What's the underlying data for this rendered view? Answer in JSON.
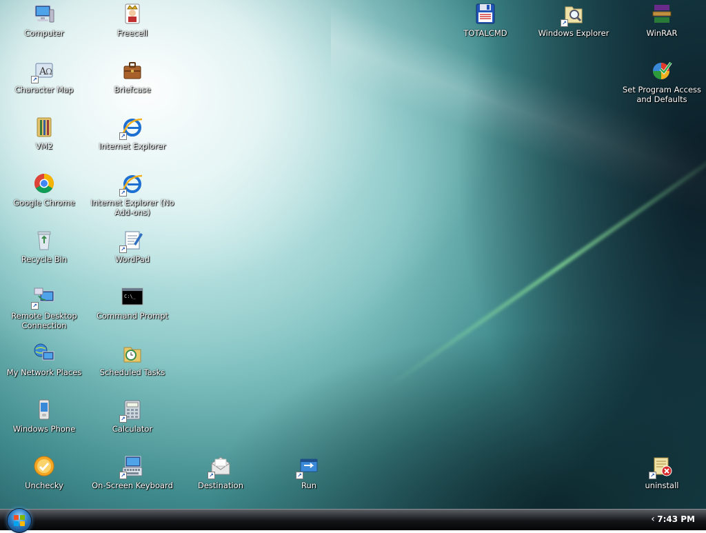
{
  "desktop": {
    "icons": {
      "computer": "Computer",
      "freecell": "Freecell",
      "totalcmd": "TOTALCMD",
      "windows_explorer": "Windows Explorer",
      "winrar": "WinRAR",
      "character_map": "Character Map",
      "briefcase": "Briefcase",
      "set_program_access": "Set Program Access and Defaults",
      "vm2": "VM2",
      "internet_explorer": "Internet Explorer",
      "google_chrome": "Google Chrome",
      "internet_explorer_no_addons": "Internet Explorer (No Add-ons)",
      "recycle_bin": "Recycle Bin",
      "wordpad": "WordPad",
      "remote_desktop": "Remote Desktop Connection",
      "command_prompt": "Command Prompt",
      "my_network_places": "My Network Places",
      "scheduled_tasks": "Scheduled Tasks",
      "windows_phone": "Windows Phone",
      "calculator": "Calculator",
      "unchecky": "Unchecky",
      "on_screen_keyboard": "On-Screen Keyboard",
      "destination": "Destination",
      "run": "Run",
      "uninstall": "uninstall"
    }
  },
  "taskbar": {
    "tray_chevron": "‹",
    "clock": "7:43 PM"
  },
  "colors": {
    "flag_red": "#f25022",
    "flag_green": "#7fba00",
    "flag_blue": "#00a4ef",
    "flag_yellow": "#ffb900"
  }
}
